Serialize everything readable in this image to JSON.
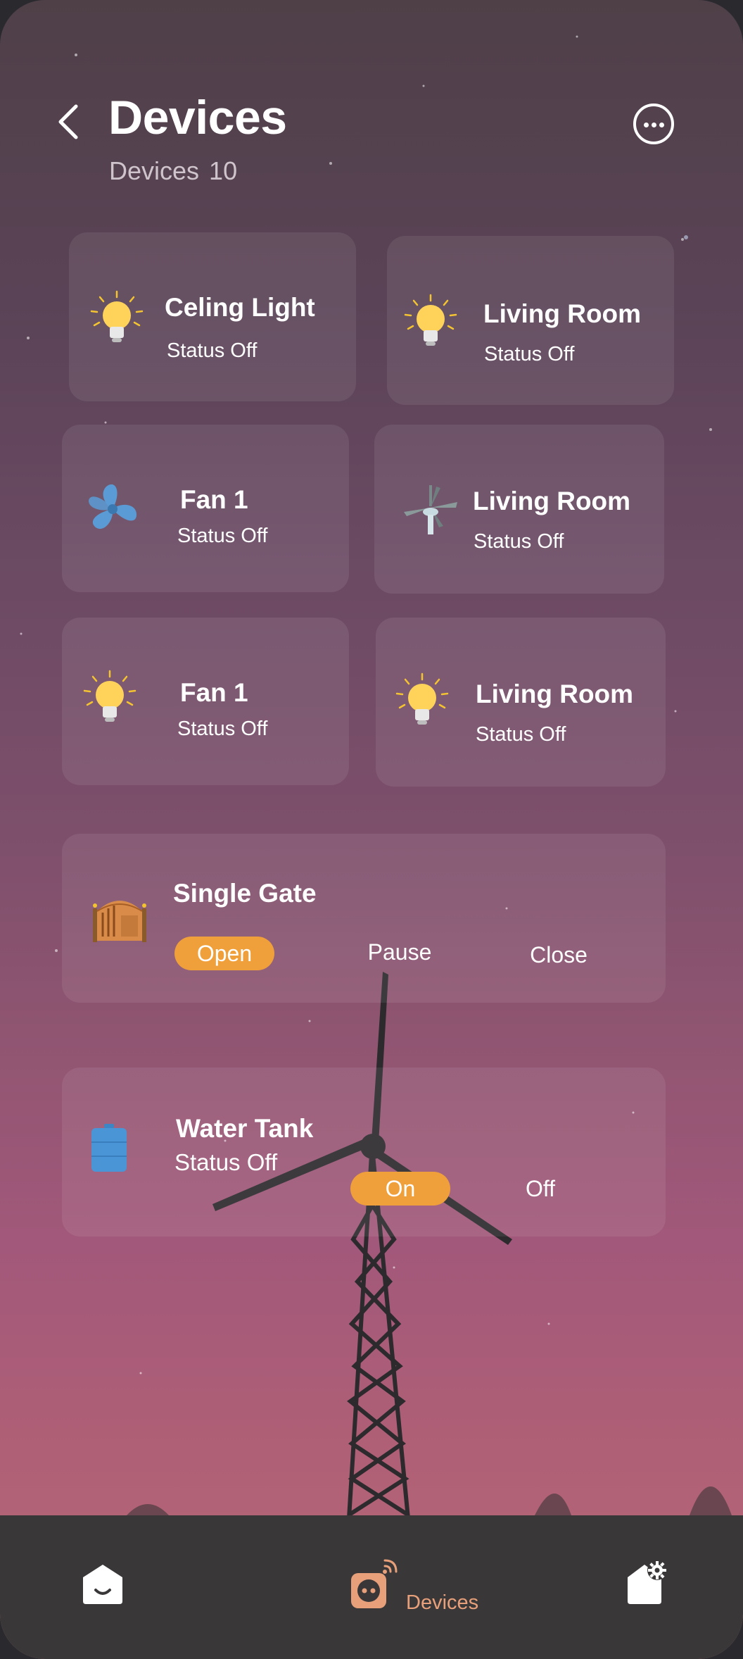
{
  "header": {
    "title": "Devices",
    "subtitle_label": "Devices",
    "subtitle_count": "10"
  },
  "devices": [
    {
      "name": "Celing Light",
      "status": "Status Off",
      "icon": "bulb-icon"
    },
    {
      "name": "Living Room",
      "status": "Status Off",
      "icon": "bulb-icon"
    },
    {
      "name": "Fan 1",
      "status": "Status Off",
      "icon": "fan-icon"
    },
    {
      "name": "Living Room",
      "status": "Status Off",
      "icon": "ceiling-fan-icon"
    },
    {
      "name": "Fan 1",
      "status": "Status Off",
      "icon": "bulb-icon"
    },
    {
      "name": "Living Room",
      "status": "Status Off",
      "icon": "bulb-icon"
    }
  ],
  "gate": {
    "name": "Single Gate",
    "icon": "gate-icon",
    "actions": [
      "Open",
      "Pause",
      "Close"
    ],
    "active_action": "Open"
  },
  "tank": {
    "name": "Water Tank",
    "status": "Status Off",
    "icon": "water-tank-icon",
    "actions": [
      "On",
      "Off"
    ],
    "active_action": "On"
  },
  "tabbar": {
    "devices_label": "Devices",
    "active_tab": "Devices"
  },
  "colors": {
    "accent": "#f0a03a",
    "tab_active": "#e8a07a"
  }
}
